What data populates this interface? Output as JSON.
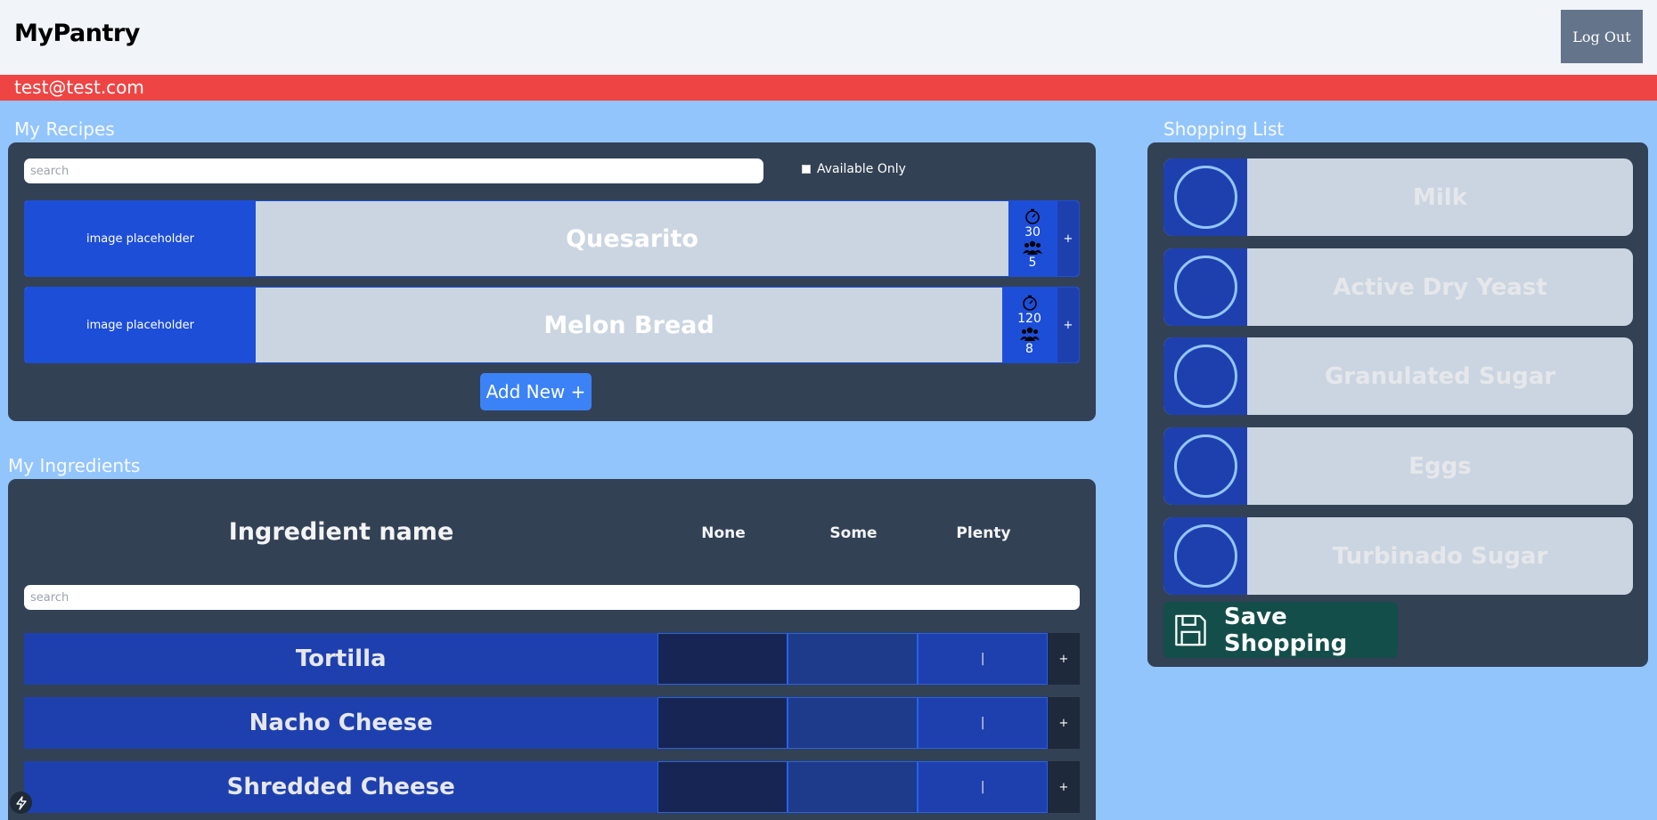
{
  "header": {
    "title": "MyPantry",
    "logout_label": "Log Out"
  },
  "user": {
    "email": "test@test.com"
  },
  "recipes": {
    "label": "My Recipes",
    "search_placeholder": "search",
    "available_only_label": "Available Only",
    "items": [
      {
        "image": "image placeholder",
        "name": "Quesarito",
        "time": "30",
        "servings": "5",
        "add": "+"
      },
      {
        "image": "image placeholder",
        "name": "Melon Bread",
        "time": "120",
        "servings": "8",
        "add": "+"
      }
    ],
    "add_new_label": "Add New +"
  },
  "ingredients": {
    "label": "My Ingredients",
    "headers": {
      "name": "Ingredient name",
      "none": "None",
      "some": "Some",
      "plenty": "Plenty"
    },
    "search_placeholder": "search",
    "items": [
      {
        "name": "Tortilla",
        "level": "plenty",
        "marker": "|",
        "add": "+"
      },
      {
        "name": "Nacho Cheese",
        "level": "plenty",
        "marker": "|",
        "add": "+"
      },
      {
        "name": "Shredded Cheese",
        "level": "plenty",
        "marker": "|",
        "add": "+"
      }
    ]
  },
  "shopping": {
    "label": "Shopping List",
    "items": [
      {
        "name": "Milk"
      },
      {
        "name": "Active Dry Yeast"
      },
      {
        "name": "Granulated Sugar"
      },
      {
        "name": "Eggs"
      },
      {
        "name": "Turbinado Sugar"
      }
    ],
    "save_label": "Save Shopping"
  },
  "icons": {
    "timer": "timer-icon",
    "servings": "users-icon",
    "save": "floppy-disk-icon",
    "checkbox": "circle-checkbox-icon",
    "corner": "lightning-icon"
  },
  "colors": {
    "background": "#93c5fd",
    "header": "#f1f4f8",
    "user_bar": "#ef4444",
    "panel": "#334155",
    "accent": "#1d4ed8",
    "add_button": "#3b82f6",
    "save_button": "#134e4a"
  }
}
